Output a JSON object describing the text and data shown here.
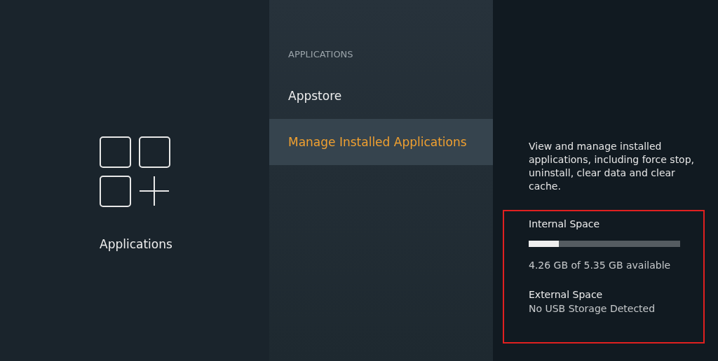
{
  "category": {
    "label": "Applications"
  },
  "menu": {
    "heading": "APPLICATIONS",
    "items": [
      {
        "label": "Appstore",
        "selected": false
      },
      {
        "label": "Manage Installed Applications",
        "selected": true
      }
    ]
  },
  "details": {
    "description": "View and manage installed applications, including force stop, uninstall, clear data and clear cache.",
    "internal": {
      "title": "Internal Space",
      "level": 0.2,
      "reading": "4.26 GB of 5.35 GB available"
    },
    "external": {
      "title": "External Space",
      "reading": "No USB Storage Detected"
    }
  }
}
